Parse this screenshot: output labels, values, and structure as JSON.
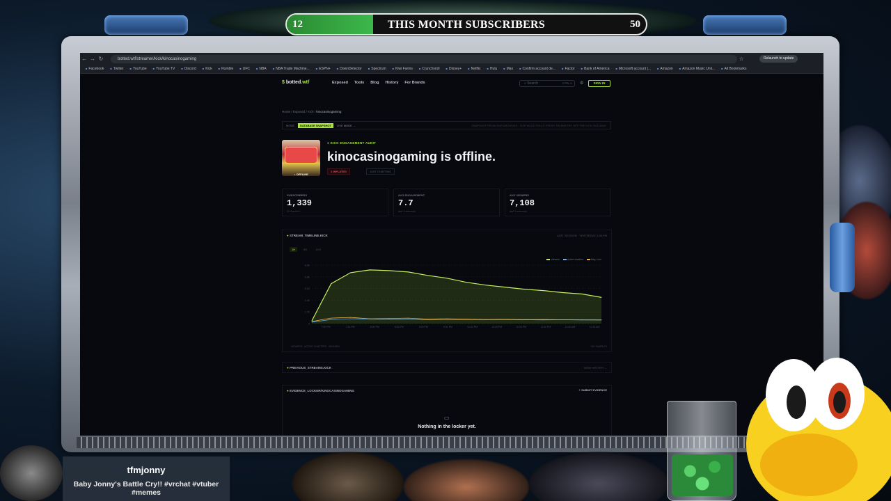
{
  "goal": {
    "current": "12",
    "max": "50",
    "title": "THIS MONTH SUBSCRIBERS",
    "progress": 0.24
  },
  "browser": {
    "url": "botted.wtf/streamer/kick/kinocasinogaming",
    "relaunch": "Relaunch to update",
    "bookmarks": [
      "Facebook",
      "Twitter",
      "YouTube",
      "YouTube TV",
      "Discord",
      "Kick",
      "Rumble",
      "UFC",
      "NBA",
      "NBA Trade Machine...",
      "ESPN+",
      "DownDetector",
      "Spectrum",
      "Kiwi Farms",
      "Crunchyroll",
      "Disney+",
      "Netflix",
      "Hulu",
      "Max",
      "Confirm account de...",
      "Factor",
      "Bank of America",
      "Microsoft account |...",
      "Amazon",
      "Amazon Music Unli..."
    ],
    "all_bookmarks": "All Bookmarks"
  },
  "site": {
    "logo_prefix": "botted",
    "logo_suffix": "wtf",
    "nav": [
      "Exposed",
      "Tools",
      "Blog",
      "History",
      "For Brands"
    ],
    "search_placeholder": "Search",
    "search_key": "CTRL K",
    "signin": "SIGN IN"
  },
  "breadcrumb": {
    "home": "Home",
    "exposed": "Exposed",
    "kick": "Kick",
    "current": "kinocasinogaming"
  },
  "mode": {
    "label": "MODE",
    "snapshot": "DATABASE SNAPSHOT",
    "live": "LIVE MODE →",
    "note": "SNAPSHOT FROM OUR ARCHIVES · LIVE MODE PULLS FRESH TELEMETRY OFF THE KICK GATEWAY"
  },
  "profile": {
    "audit_label": "KICK ENGAGEMENT AUDIT",
    "title": "kinocasinogaming is offline.",
    "status_badge": "OFFLINE",
    "tag_inflated": "1 INFLATED",
    "tag_just": "JUST CHATTING"
  },
  "stats": [
    {
      "label": "SUBSCRIBERS",
      "value": "1,339",
      "sub": "33 tracked"
    },
    {
      "label": "AVG ENGAGEMENT",
      "value": "7.7",
      "sub": "last 3 streams"
    },
    {
      "label": "AVG VIEWERS",
      "value": "7,108",
      "sub": "last 3 streams"
    }
  ],
  "timeline": {
    "title": "STREAM_TIMELINE.KICK",
    "last_session": "LAST SESSION · YESTERDAY 5:38 PM",
    "ranges": [
      "1H",
      "6H",
      "12H"
    ],
    "legend": [
      "Viewers",
      "Active chatters",
      "Msg / min"
    ],
    "footer_left": "VIEWERS · ACTIVE CHATTERS · MSG/MIN",
    "footer_right": "510 SAMPLES"
  },
  "chart_data": {
    "type": "line",
    "x": [
      "7:00 PM",
      "7:30 PM",
      "8:00 PM",
      "8:30 PM",
      "9:00 PM",
      "9:30 PM",
      "10:00 PM",
      "10:30 PM",
      "11:00 PM",
      "11:30 PM",
      "12:00 AM",
      "12:30 AM"
    ],
    "yticks": [
      "0",
      "1.7K",
      "3.4K",
      "5.1K",
      "6.8K",
      "8.5K"
    ],
    "ylim": [
      0,
      8500
    ],
    "series": [
      {
        "name": "Viewers",
        "values": [
          400,
          5800,
          7400,
          7800,
          7700,
          7500,
          7000,
          6600,
          6000,
          5600,
          5300,
          5000,
          4800,
          4500,
          4300,
          3800
        ]
      },
      {
        "name": "Active chatters",
        "values": [
          200,
          600,
          700,
          650,
          600,
          620,
          580,
          600,
          590,
          560,
          580,
          550,
          540,
          560,
          530,
          520
        ]
      },
      {
        "name": "Msg / min",
        "values": [
          300,
          800,
          900,
          700,
          750,
          800,
          650,
          700,
          650,
          600,
          620,
          580,
          600,
          560,
          550,
          540
        ]
      }
    ],
    "colors": [
      "#c8f060",
      "#6ab0f0",
      "#f0b040"
    ]
  },
  "previous": {
    "title": "PREVIOUS_STREAMS.KICK",
    "action": "VIEW HISTORY ⌄"
  },
  "locker": {
    "title": "EVIDENCE_LOCKER/KINOCASINOGAMING",
    "submit": "+ SUBMIT EVIDENCE",
    "empty": "Nothing in the locker yet."
  },
  "overlay": {
    "username": "tfmjonny",
    "video_title": "Baby Jonny's Battle Cry!! #vrchat #vtuber #memes"
  }
}
